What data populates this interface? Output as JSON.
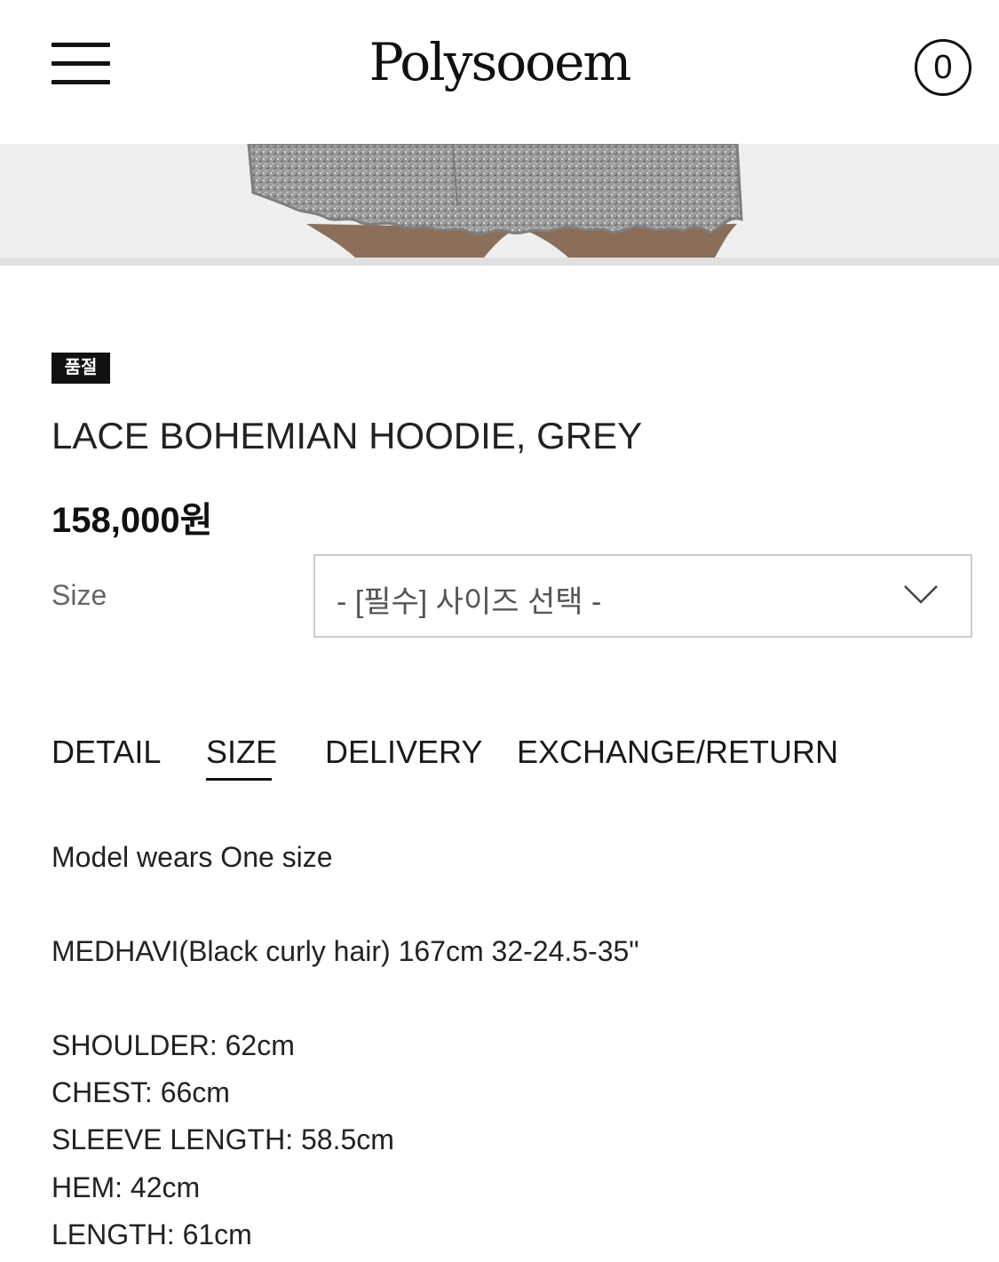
{
  "header": {
    "logo": "Polysooem",
    "cart_count": "0"
  },
  "product": {
    "badge": "품절",
    "title": "LACE BOHEMIAN HOODIE, GREY",
    "price": "158,000원"
  },
  "options": {
    "size_label": "Size",
    "size_placeholder": "- [필수] 사이즈 선택 -"
  },
  "tabs": [
    {
      "label": "DETAIL"
    },
    {
      "label": "SIZE"
    },
    {
      "label": "DELIVERY"
    },
    {
      "label": "EXCHANGE/RETURN"
    }
  ],
  "active_tab": "SIZE",
  "size_info": {
    "model_wears": "Model wears One size",
    "model_info": "MEDHAVI(Black curly hair) 167cm 32-24.5-35\"",
    "measurements": [
      "SHOULDER: 62cm",
      "CHEST: 66cm",
      "SLEEVE LENGTH: 58.5cm",
      "HEM: 42cm",
      "LENGTH: 61cm"
    ]
  },
  "icons": {
    "menu": "hamburger-menu-icon",
    "cart": "cart-count-circle",
    "dropdown": "chevron-down-icon"
  }
}
